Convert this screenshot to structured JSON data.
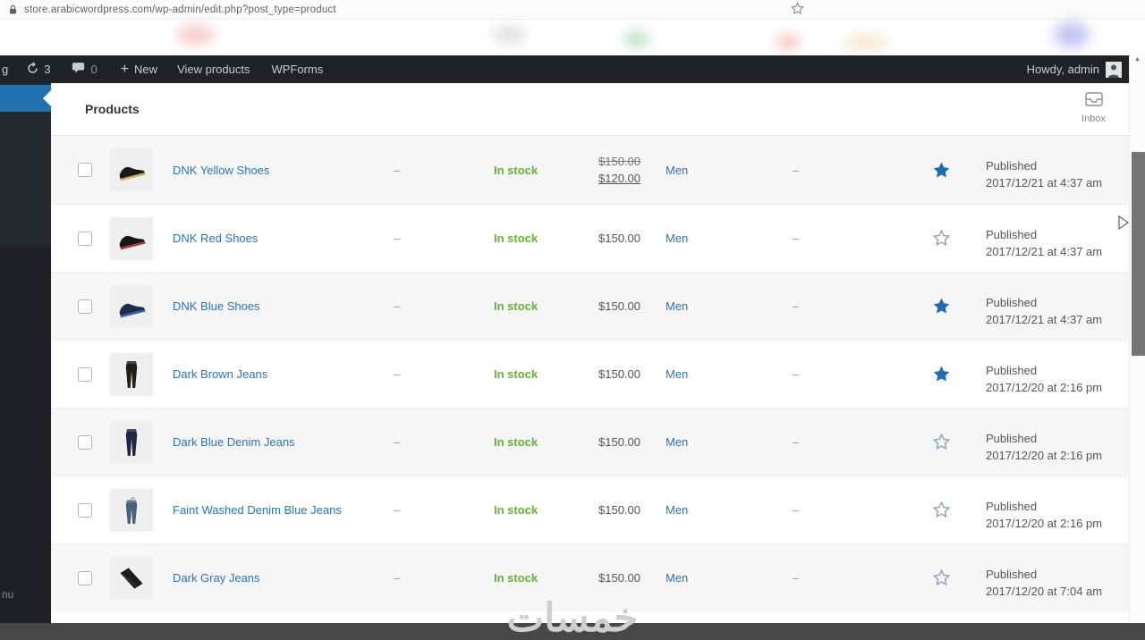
{
  "browser": {
    "url": "store.arabicwordpress.com/wp-admin/edit.php?post_type=product"
  },
  "admin_bar": {
    "site_name_partial": "g",
    "updates_count": "3",
    "comments_count": "0",
    "new_label": "New",
    "view_products_label": "View products",
    "wpforms_label": "WPForms",
    "howdy_label": "Howdy, admin"
  },
  "sidebar": {
    "collapse_menu_partial": "nu"
  },
  "page": {
    "title": "Products",
    "inbox_label": "Inbox"
  },
  "table": {
    "products": [
      {
        "name": "DNK Yellow Shoes",
        "sku": "–",
        "stock_status": "In stock",
        "price_regular": "$150.00",
        "price_sale": "$120.00",
        "categories": "Men",
        "tags": "–",
        "featured": true,
        "status": "Published",
        "date": "2017/12/21 at 4:37 am",
        "thumb": {
          "type": "shoe",
          "body": "#191919",
          "accent": "#c8b44a"
        }
      },
      {
        "name": "DNK Red Shoes",
        "sku": "–",
        "stock_status": "In stock",
        "price_regular": "$150.00",
        "price_sale": "",
        "categories": "Men",
        "tags": "–",
        "featured": false,
        "status": "Published",
        "date": "2017/12/21 at 4:37 am",
        "thumb": {
          "type": "shoe",
          "body": "#1b1415",
          "accent": "#a83434"
        }
      },
      {
        "name": "DNK Blue Shoes",
        "sku": "–",
        "stock_status": "In stock",
        "price_regular": "$150.00",
        "price_sale": "",
        "categories": "Men",
        "tags": "–",
        "featured": true,
        "status": "Published",
        "date": "2017/12/21 at 4:37 am",
        "thumb": {
          "type": "shoe",
          "body": "#1c2c49",
          "accent": "#2f5fae"
        }
      },
      {
        "name": "Dark Brown Jeans",
        "sku": "–",
        "stock_status": "In stock",
        "price_regular": "$150.00",
        "price_sale": "",
        "categories": "Men",
        "tags": "–",
        "featured": true,
        "status": "Published",
        "date": "2017/12/20 at 2:16 pm",
        "thumb": {
          "type": "jeans",
          "body": "#241d17",
          "accent": ""
        }
      },
      {
        "name": "Dark Blue Denim Jeans",
        "sku": "–",
        "stock_status": "In stock",
        "price_regular": "$150.00",
        "price_sale": "",
        "categories": "Men",
        "tags": "–",
        "featured": false,
        "status": "Published",
        "date": "2017/12/20 at 2:16 pm",
        "thumb": {
          "type": "jeans",
          "body": "#1c2940",
          "accent": ""
        }
      },
      {
        "name": "Faint Washed Denim Blue Jeans",
        "sku": "–",
        "stock_status": "In stock",
        "price_regular": "$150.00",
        "price_sale": "",
        "categories": "Men",
        "tags": "–",
        "featured": false,
        "status": "Published",
        "date": "2017/12/20 at 2:16 pm",
        "thumb": {
          "type": "jeans-hanger",
          "body": "#48617f",
          "accent": ""
        }
      },
      {
        "name": "Dark Gray Jeans",
        "sku": "–",
        "stock_status": "In stock",
        "price_regular": "$150.00",
        "price_sale": "",
        "categories": "Men",
        "tags": "–",
        "featured": false,
        "status": "Published",
        "date": "2017/12/20 at 7:04 am",
        "thumb": {
          "type": "jeans-folded",
          "body": "#1c1c1c",
          "accent": ""
        }
      }
    ]
  },
  "watermark": {
    "text": "خمسات"
  },
  "colors": {
    "accent_blue": "#2271b1",
    "link_blue": "#2874bd",
    "stock_green": "#64b239",
    "star_blue": "#1f6cb5",
    "admin_bar_bg": "#1d2327",
    "letterbox_gray": "#484848"
  }
}
